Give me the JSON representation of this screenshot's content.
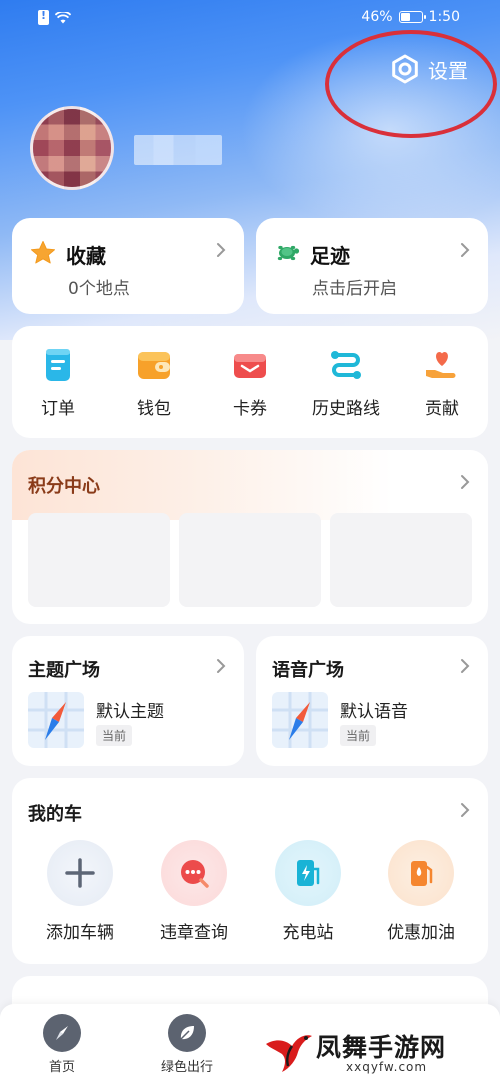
{
  "status_bar": {
    "battery": "46%",
    "time": "1:50",
    "battery_level": 0.46
  },
  "header": {
    "settings_label": "设置"
  },
  "quick_cards": [
    {
      "title": "收藏",
      "subtitle": "0个地点",
      "icon": "star-icon"
    },
    {
      "title": "足迹",
      "subtitle": "点击后开启",
      "icon": "turtle-icon"
    }
  ],
  "tools": [
    {
      "label": "订单",
      "icon": "order-icon"
    },
    {
      "label": "钱包",
      "icon": "wallet-icon"
    },
    {
      "label": "卡券",
      "icon": "coupon-icon"
    },
    {
      "label": "历史路线",
      "icon": "route-icon"
    },
    {
      "label": "贡献",
      "icon": "contribute-icon"
    }
  ],
  "points": {
    "title": "积分中心"
  },
  "theme_plaza": {
    "title": "主题广场",
    "item_name": "默认主题",
    "tag": "当前"
  },
  "voice_plaza": {
    "title": "语音广场",
    "item_name": "默认语音",
    "tag": "当前"
  },
  "my_car": {
    "title": "我的车",
    "items": [
      {
        "label": "添加车辆",
        "icon": "plus-icon"
      },
      {
        "label": "违章查询",
        "icon": "violation-icon"
      },
      {
        "label": "充电站",
        "icon": "charging-icon"
      },
      {
        "label": "优惠加油",
        "icon": "fuel-icon"
      }
    ]
  },
  "tabbar": [
    {
      "label": "首页",
      "icon": "compass-icon"
    },
    {
      "label": "绿色出行",
      "icon": "leaf-icon"
    }
  ],
  "watermark": {
    "text": "凤舞手游网",
    "url": "xxqyfw.com"
  },
  "colors": {
    "accent": "#2f7cf0",
    "highlight_ring": "#d9303a",
    "points_title": "#8a3b19"
  }
}
